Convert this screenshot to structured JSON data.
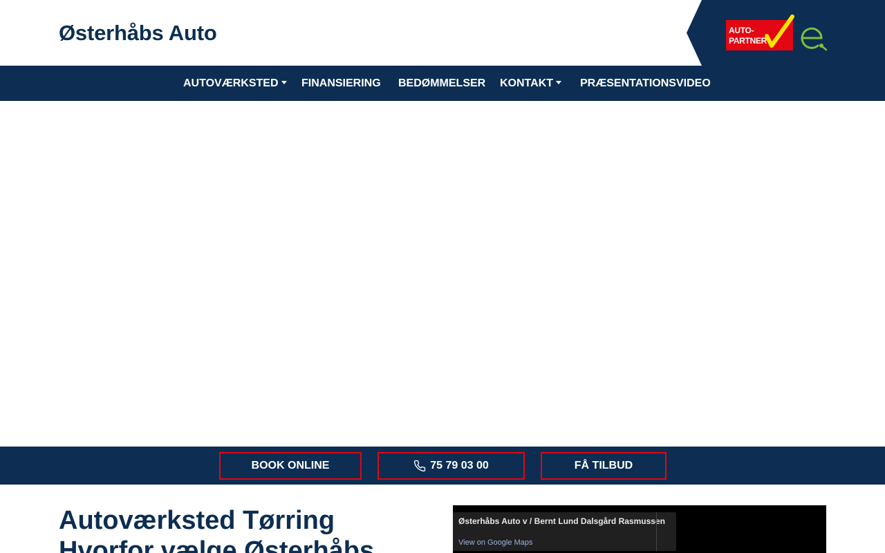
{
  "header": {
    "brand": "Østerhåbs Auto",
    "logo": {
      "line1": "AUTO-",
      "line2": "PARTNER"
    }
  },
  "nav": {
    "items": [
      {
        "label": "AUTOVÆRKSTED",
        "dropdown": true
      },
      {
        "label": "FINANSIERING",
        "dropdown": false
      },
      {
        "label": "BEDØMMELSER",
        "dropdown": false
      },
      {
        "label": "KONTAKT",
        "dropdown": true
      },
      {
        "label": "PRÆSENTATIONSVIDEO",
        "dropdown": false
      }
    ]
  },
  "cta": {
    "book": "BOOK ONLINE",
    "phone": "75 79 03 00",
    "offer": "FÅ TILBUD"
  },
  "content": {
    "heading": "Autoværksted Tørring",
    "subheading": "Hvorfor vælge Østerhåbs"
  },
  "map": {
    "title": "Østerhåbs Auto v / Bernt Lund Dalsgård Rasmussen",
    "link": "View on Google Maps"
  },
  "colors": {
    "navy": "#0d2e52",
    "red": "#e30613",
    "green": "#7ac142",
    "yellow": "#ffe500"
  },
  "icons": [
    "autopartner-logo",
    "e-charging-icon",
    "caret-down-icon",
    "phone-icon"
  ]
}
